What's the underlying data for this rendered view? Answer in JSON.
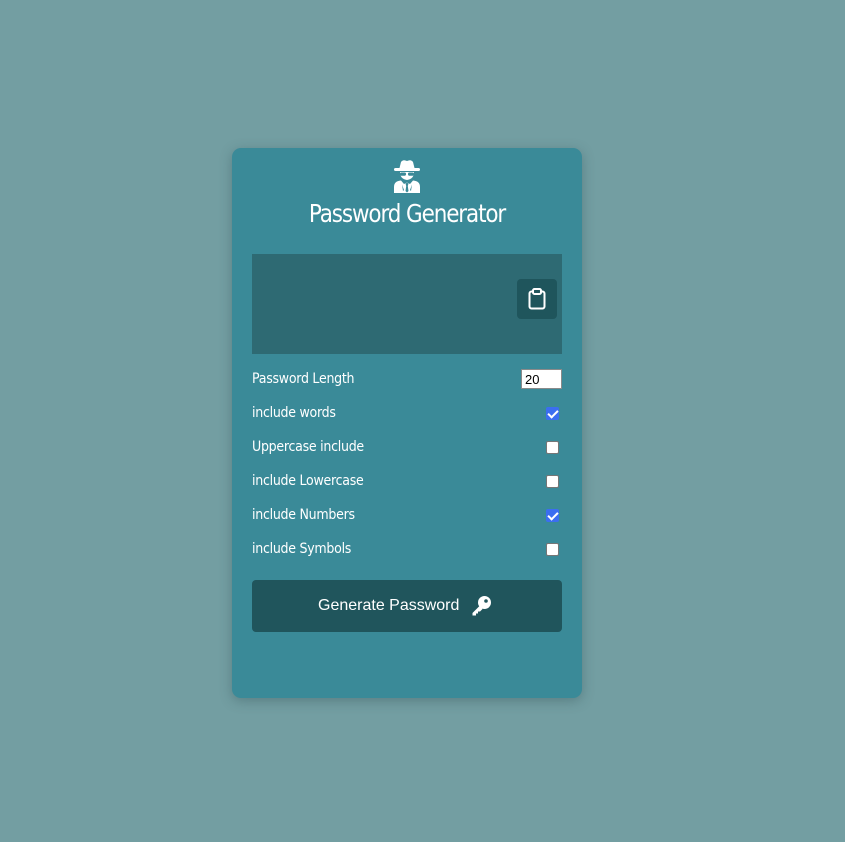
{
  "app": {
    "title": "Password Generator",
    "icon": "user-secret-icon"
  },
  "result": {
    "password": "",
    "copy_icon": "clipboard-icon"
  },
  "settings": {
    "length": {
      "label": "Password Length",
      "value": "20"
    },
    "words": {
      "label": "include words",
      "checked": true
    },
    "uppercase": {
      "label": "Uppercase include",
      "checked": false
    },
    "lowercase": {
      "label": "include Lowercase",
      "checked": false
    },
    "numbers": {
      "label": "include Numbers",
      "checked": true
    },
    "symbols": {
      "label": "include Symbols",
      "checked": false
    }
  },
  "generate": {
    "label": "Generate Password",
    "icon": "key-icon"
  },
  "colors": {
    "background": "#739ea2",
    "card": "#3a8a98",
    "result_box": "#2e6a73",
    "button": "#20555c",
    "checkbox_accent": "#3b6ef0"
  }
}
